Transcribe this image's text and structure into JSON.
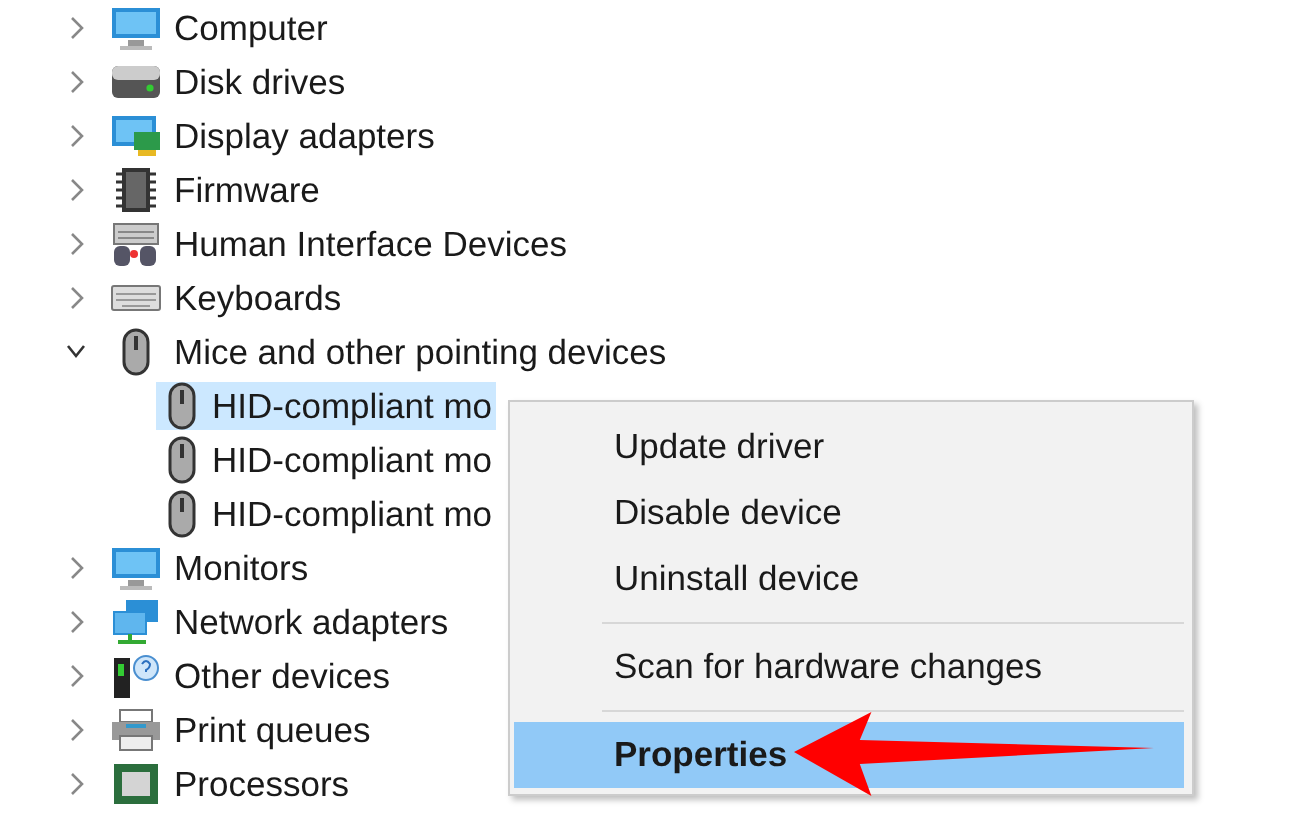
{
  "tree": [
    {
      "label": "Computer",
      "expanded": false
    },
    {
      "label": "Disk drives",
      "expanded": false
    },
    {
      "label": "Display adapters",
      "expanded": false
    },
    {
      "label": "Firmware",
      "expanded": false
    },
    {
      "label": "Human Interface Devices",
      "expanded": false
    },
    {
      "label": "Keyboards",
      "expanded": false
    },
    {
      "label": "Mice and other pointing devices",
      "expanded": true,
      "children": [
        {
          "label": "HID-compliant mo",
          "selected": true
        },
        {
          "label": "HID-compliant mo",
          "selected": false
        },
        {
          "label": "HID-compliant mo",
          "selected": false
        }
      ]
    },
    {
      "label": "Monitors",
      "expanded": false
    },
    {
      "label": "Network adapters",
      "expanded": false
    },
    {
      "label": "Other devices",
      "expanded": false
    },
    {
      "label": "Print queues",
      "expanded": false
    },
    {
      "label": "Processors",
      "expanded": false
    }
  ],
  "context_menu": [
    {
      "kind": "item",
      "label": "Update driver",
      "selected": false
    },
    {
      "kind": "item",
      "label": "Disable device",
      "selected": false
    },
    {
      "kind": "item",
      "label": "Uninstall device",
      "selected": false
    },
    {
      "kind": "separator"
    },
    {
      "kind": "item",
      "label": "Scan for hardware changes",
      "selected": false
    },
    {
      "kind": "separator"
    },
    {
      "kind": "item",
      "label": "Properties",
      "selected": true
    }
  ]
}
